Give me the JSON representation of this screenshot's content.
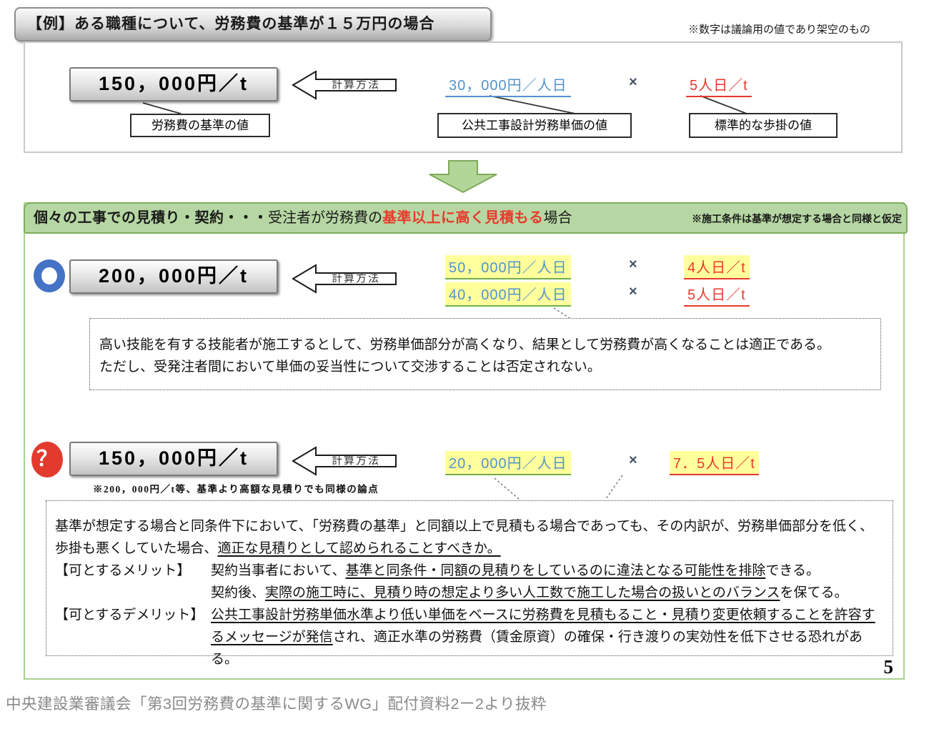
{
  "calc_method_label": "計算方法",
  "multiply_sign": "×",
  "example": {
    "title": "【例】ある職種について、労務費の基準が１５万円の場合",
    "note": "※数字は議論用の値であり架空のもの",
    "value": "150，000円／t",
    "value_label": "労務費の基準の値",
    "unit_price": "30，000円／人日",
    "unit_price_label": "公共工事設計労務単価の値",
    "crew": "5人日／t",
    "crew_label": "標準的な歩掛の値"
  },
  "main": {
    "header": {
      "lead": "個々の工事での見積り・契約・・・",
      "mid": "受注者が労務費の",
      "red": "基準以上に高く見積もる",
      "tail": "場合",
      "note": "※施工条件は基準が想定する場合と同様と仮定"
    },
    "case1": {
      "mark": "○",
      "value": "200，000円／t",
      "rows": [
        {
          "price": "50，000円／人日",
          "crew": "4人日／t"
        },
        {
          "price": "40，000円／人日",
          "crew": "5人日／t"
        }
      ],
      "comment_line1": "高い技能を有する技能者が施工するとして、労務単価部分が高くなり、結果として労務費が高くなることは適正である。",
      "comment_line2": "ただし、受発注者間において単価の妥当性について交渉することは否定されない。"
    },
    "case2": {
      "mark": "？",
      "value": "150，000円／t",
      "subnote": "※200，000円／t等、基準より高額な見積りでも同様の論点",
      "price": "20，000円／人日",
      "crew": "7．5人日／t",
      "comment": {
        "line1": "基準が想定する場合と同条件下において、「労務費の基準」と同額以上で見積もる場合であっても、その内訳が、労務単価部分を低く、",
        "line2_pre": "歩掛も悪くしていた場合、",
        "line2_u": "適正な見積りとして認められることすべきか。",
        "merit_label": "【可とするメリット】",
        "merit1_pre": "契約当事者において、",
        "merit1_u": "基準と同条件・同額の見積りをしているのに違法となる可能性を排除",
        "merit1_post": "できる。",
        "merit2_pre": "契約後、",
        "merit2_u": "実際の施工時に、見積り時の想定より多い人工数で施工した場合の扱いとのバランス",
        "merit2_post": "を保てる。",
        "demerit_label": "【可とするデメリット】",
        "demerit1_u": "公共工事設計労務単価水準より低い単価をベースに労務費を見積もること・見積り変更依頼することを許容す",
        "demerit2_u": "るメッセージが発信",
        "demerit2_post": "され、適正水準の労務費（賃金原資）の確保・行き渡りの実効性を低下させる恐れがある。"
      }
    },
    "page_number": "5"
  },
  "caption": "中央建設業審議会「第3回労務費の基準に関するWG」配付資料2ー2より抜粋",
  "colors": {
    "section_green_bg": "#b6d7a3",
    "section_green_border": "#7eae5c",
    "highlight_yellow": "#ffff9c",
    "value_blue": "#4f93ce",
    "alert_red": "#e8392b",
    "circle_blue": "#4472c4",
    "gray_box": "#d9d9d9"
  }
}
